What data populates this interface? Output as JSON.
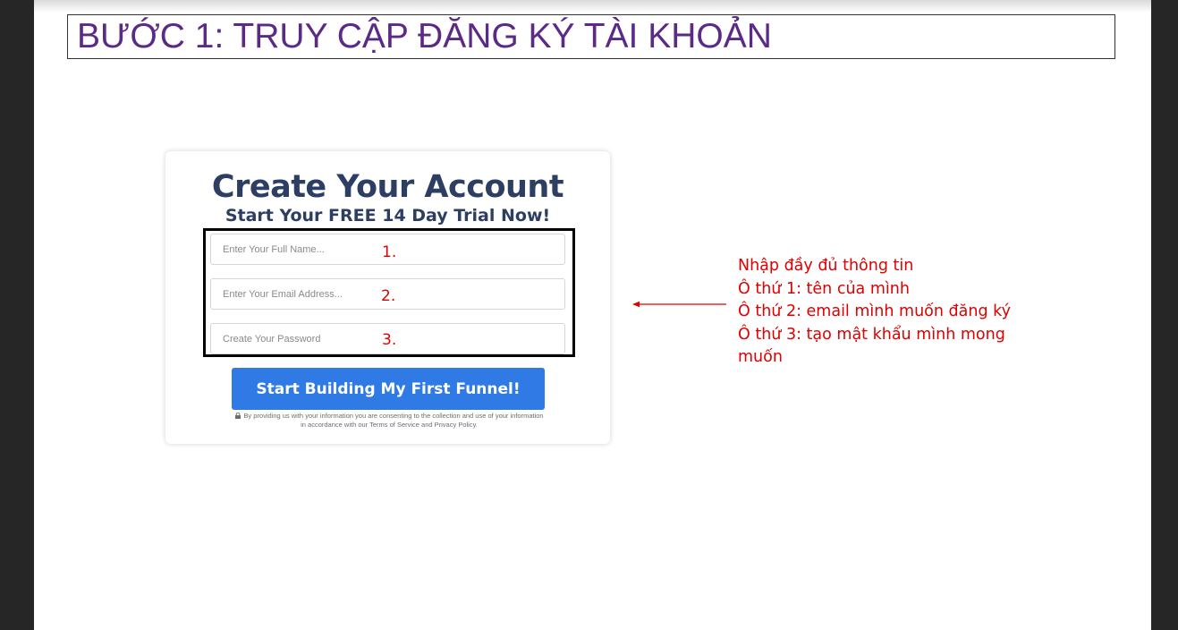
{
  "slide": {
    "title": "BƯỚC 1: TRUY CẬP ĐĂNG KÝ TÀI KHOẢN"
  },
  "form": {
    "title": "Create Your Account",
    "subtitle": "Start Your FREE 14 Day Trial Now!",
    "fields": [
      {
        "placeholder": "Enter Your Full Name...",
        "marker": "1."
      },
      {
        "placeholder": "Enter Your Email Address...",
        "marker": "2."
      },
      {
        "placeholder": "Create Your Password",
        "marker": "3."
      }
    ],
    "submit_label": "Start Building My First Funnel!",
    "disclaimer_line1": "By providing us with your information you are consenting to the collection and use of your information",
    "disclaimer_line2": "in accordance with our Terms of Service and Privacy Policy.",
    "lock_icon": "lock-icon"
  },
  "annotation": {
    "lines": [
      "Nhập đầy đủ thông tin",
      "Ô thứ 1: tên của mình",
      "Ô thứ 2: email mình muốn đăng ký",
      "Ô thứ 3: tạo mật khẩu mình mong muốn"
    ],
    "arrow_icon": "arrow-left-icon"
  },
  "colors": {
    "title": "#5b2a86",
    "form_heading": "#2d3e63",
    "button": "#2f7ae5",
    "annotation": "#e00000"
  }
}
